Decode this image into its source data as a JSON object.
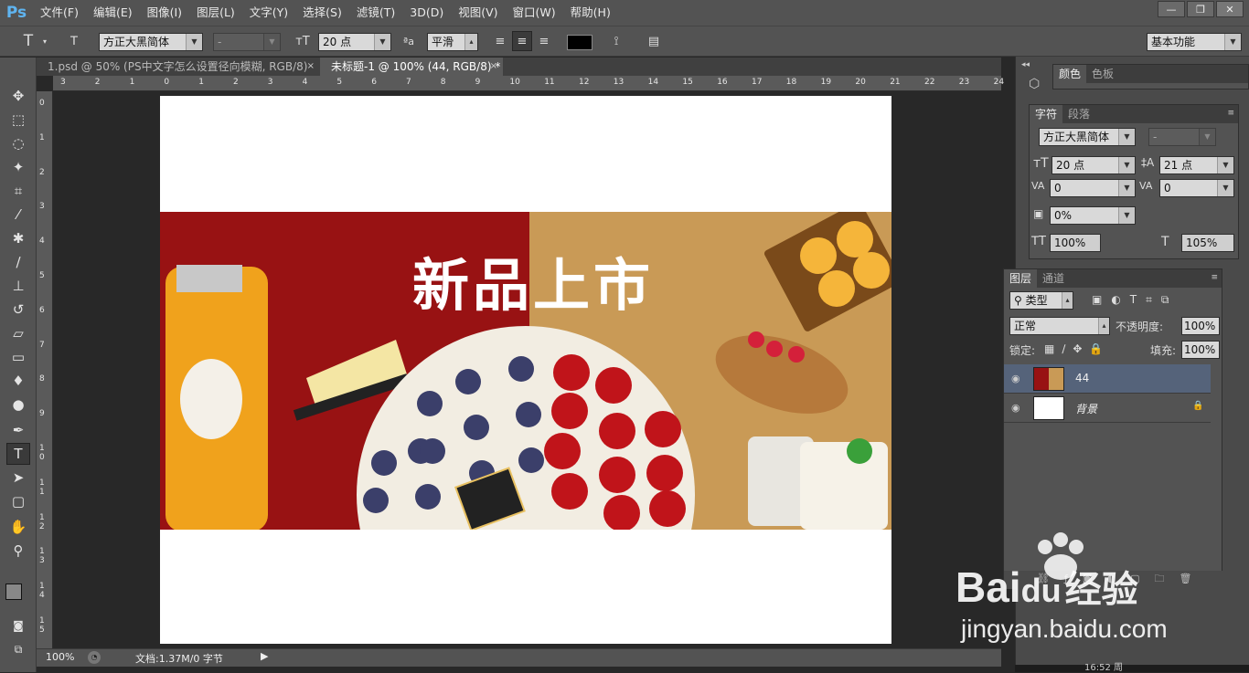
{
  "app": {
    "logo": "Ps"
  },
  "menu": [
    "文件(F)",
    "编辑(E)",
    "图像(I)",
    "图层(L)",
    "文字(Y)",
    "选择(S)",
    "滤镜(T)",
    "3D(D)",
    "视图(V)",
    "窗口(W)",
    "帮助(H)"
  ],
  "window_controls": {
    "minimize": "—",
    "restore": "❐",
    "close": "✕"
  },
  "options": {
    "font_family": "方正大黑简体",
    "font_style": "-",
    "font_size": "20 点",
    "aa_icon": "ªa",
    "antialias": "平滑",
    "workspace": "基本功能"
  },
  "tabs": [
    {
      "label": "1.psd @ 50% (PS中文字怎么设置径向模糊, RGB/8)",
      "close": "×"
    },
    {
      "label": "未标题-1 @ 100% (44, RGB/8) *",
      "close": "×"
    }
  ],
  "ruler_h": [
    "3",
    "2",
    "1",
    "0",
    "1",
    "2",
    "3",
    "4",
    "5",
    "6",
    "7",
    "8",
    "9",
    "10",
    "11",
    "12",
    "13",
    "14",
    "15",
    "16",
    "17",
    "18",
    "19",
    "20",
    "21",
    "22",
    "23",
    "24"
  ],
  "ruler_v": [
    "0",
    "1",
    "2",
    "3",
    "4",
    "5",
    "6",
    "7",
    "8",
    "9",
    "1 0",
    "1 1",
    "1 2",
    "1 3",
    "1 4",
    "1 5"
  ],
  "canvas": {
    "headline": "新品上市"
  },
  "status": {
    "zoom": "100%",
    "doc_info": "文档:1.37M/0 字节"
  },
  "panels": {
    "color_tabs": [
      "颜色",
      "色板"
    ],
    "char_tabs": [
      "字符",
      "段落"
    ],
    "character": {
      "font_family": "方正大黑简体",
      "font_style": "-",
      "size": "20 点",
      "leading": "21 点",
      "kerning": "0",
      "tracking": "0",
      "tsume": "0%",
      "v_scale": "100%",
      "h_scale": "105%"
    },
    "layers_tabs": [
      "图层",
      "通道"
    ],
    "layers": {
      "filter": "类型",
      "blend_mode": "正常",
      "opacity_label": "不透明度:",
      "opacity": "100%",
      "lock_label": "锁定:",
      "fill_label": "填充:",
      "fill": "100%",
      "items": [
        {
          "name": "44",
          "selected": true
        },
        {
          "name": "背景",
          "selected": false
        }
      ]
    }
  },
  "watermark": {
    "brand": "Bai",
    "brand2": "du",
    "suffix": "经验",
    "url": "jingyan.baidu.com"
  },
  "taskbar": {
    "time": "16:52 周"
  }
}
